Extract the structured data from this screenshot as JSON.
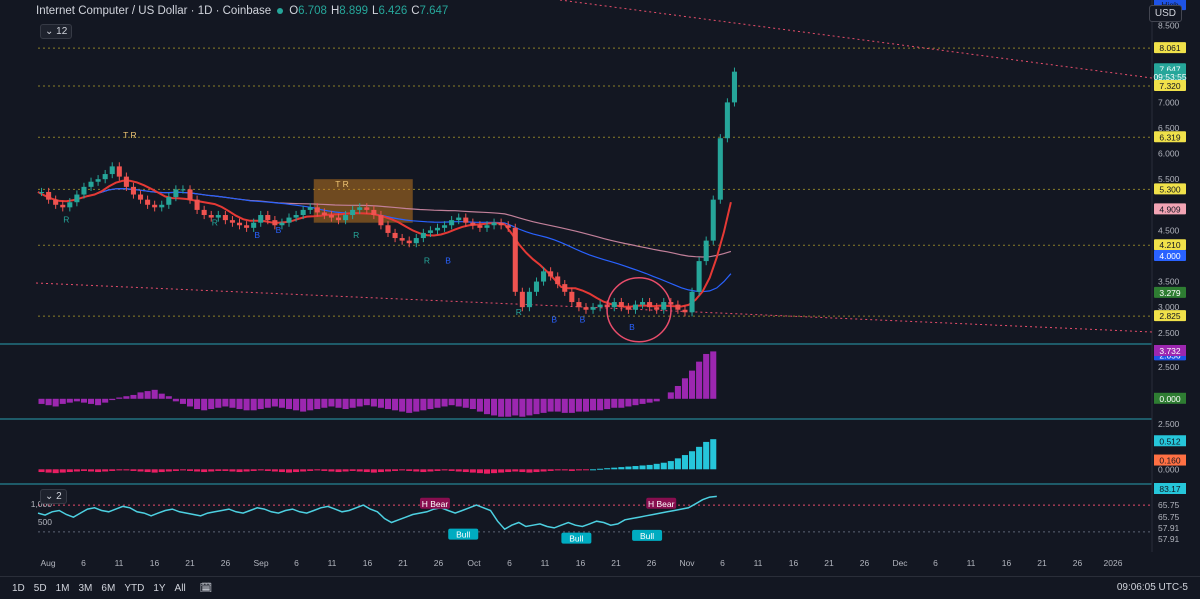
{
  "header": {
    "title": "Internet Computer / US Dollar · 1D · Coinbase",
    "ohlc": [
      {
        "k": "O",
        "v": "6.708"
      },
      {
        "k": "H",
        "v": "8.899"
      },
      {
        "k": "L",
        "v": "6.426"
      },
      {
        "k": "C",
        "v": "7.647"
      }
    ],
    "interval_chip": "12",
    "volume_chip": "2",
    "currency": "USD"
  },
  "footer": {
    "ranges": [
      "1D",
      "5D",
      "1M",
      "3M",
      "6M",
      "YTD",
      "1Y",
      "All"
    ],
    "clock": "09:06:05 UTC-5"
  },
  "colors": {
    "bg": "#131722",
    "up": "#26a69a",
    "down": "#ef5350",
    "accent_yellow": "#f0e14a",
    "ema_red": "#e53935",
    "ma_blue": "#2962ff",
    "ma_pink": "#c2809a"
  },
  "chart_data": [
    {
      "type": "line",
      "panel": "price",
      "y_ticks": [
        "2.500",
        "3.000",
        "3.500",
        "4.500",
        "5.500",
        "6.000",
        "6.500",
        "7.000",
        "8.500"
      ],
      "ylim": [
        2.3,
        9.0
      ],
      "x_ticks": [
        "Aug",
        "6",
        "11",
        "16",
        "21",
        "26",
        "Sep",
        "6",
        "11",
        "16",
        "21",
        "26",
        "Oct",
        "6",
        "11",
        "16",
        "21",
        "26",
        "Nov",
        "6",
        "11",
        "16",
        "21",
        "26",
        "Dec",
        "6",
        "11",
        "16",
        "21",
        "26",
        "2026"
      ],
      "price_labels": [
        {
          "text": "High",
          "color": "#131722",
          "bg": "#1e53e5",
          "value": 8.9
        },
        {
          "text": "8.061",
          "color": "#131722",
          "bg": "#f0e14a",
          "value": 8.061
        },
        {
          "text": "7.647",
          "color": "#ffffff",
          "bg": "#26a69a",
          "value": 7.647
        },
        {
          "text": "09:53:55",
          "color": "#ffffff",
          "bg": "#26a69a",
          "value": 7.5
        },
        {
          "text": "7.320",
          "color": "#131722",
          "bg": "#f0e14a",
          "value": 7.32
        },
        {
          "text": "6.319",
          "color": "#131722",
          "bg": "#f0e14a",
          "value": 6.319
        },
        {
          "text": "5.300",
          "color": "#131722",
          "bg": "#f0e14a",
          "value": 5.3
        },
        {
          "text": "4.909",
          "color": "#131722",
          "bg": "#f2a4b4",
          "value": 4.909
        },
        {
          "text": "4.210",
          "color": "#131722",
          "bg": "#f0e14a",
          "value": 4.21
        },
        {
          "text": "4.000",
          "color": "#ffffff",
          "bg": "#2962ff",
          "value": 4.0
        },
        {
          "text": "3.279",
          "color": "#ffffff",
          "bg": "#2e7d32",
          "value": 3.279
        },
        {
          "text": "2.825",
          "color": "#131722",
          "bg": "#f0e14a",
          "value": 2.825
        },
        {
          "text": "Low",
          "color": "#ffffff",
          "bg": "#1e53e5",
          "value": 2.06
        },
        {
          "text": "2.056",
          "color": "#ffffff",
          "bg": "#1e53e5",
          "value": 2.06
        }
      ],
      "closes": [
        5.25,
        5.1,
        5.0,
        4.95,
        5.05,
        5.2,
        5.35,
        5.45,
        5.5,
        5.6,
        5.75,
        5.55,
        5.35,
        5.2,
        5.1,
        5.0,
        4.95,
        5.0,
        5.15,
        5.3,
        5.3,
        5.1,
        4.9,
        4.8,
        4.75,
        4.8,
        4.7,
        4.65,
        4.6,
        4.55,
        4.65,
        4.8,
        4.7,
        4.6,
        4.65,
        4.75,
        4.8,
        4.9,
        4.95,
        4.85,
        4.8,
        4.75,
        4.7,
        4.8,
        4.9,
        4.95,
        4.9,
        4.8,
        4.6,
        4.45,
        4.35,
        4.3,
        4.25,
        4.35,
        4.45,
        4.5,
        4.55,
        4.6,
        4.7,
        4.75,
        4.65,
        4.6,
        4.55,
        4.6,
        4.65,
        4.6,
        4.55,
        3.3,
        3.0,
        3.3,
        3.5,
        3.7,
        3.6,
        3.45,
        3.3,
        3.1,
        3.0,
        2.95,
        3.0,
        3.05,
        3.0,
        3.1,
        3.0,
        2.95,
        3.05,
        3.1,
        3.0,
        2.95,
        3.1,
        3.05,
        2.95,
        2.9,
        3.3,
        3.9,
        4.3,
        5.1,
        6.3,
        7.0,
        7.6
      ],
      "annotations": [
        {
          "text": "T R",
          "day": 13,
          "value": 6.3,
          "color": "#f0c674"
        },
        {
          "text": "T R",
          "day": 43,
          "value": 5.35,
          "color": "#f0c674"
        },
        {
          "text": "R",
          "day": 4,
          "value": 4.65,
          "color": "#26a69a"
        },
        {
          "text": "R",
          "day": 25,
          "value": 4.6,
          "color": "#26a69a"
        },
        {
          "text": "B",
          "day": 31,
          "value": 4.35,
          "color": "#2962ff"
        },
        {
          "text": "B",
          "day": 34,
          "value": 4.45,
          "color": "#2962ff"
        },
        {
          "text": "R",
          "day": 45,
          "value": 4.35,
          "color": "#26a69a"
        },
        {
          "text": "R",
          "day": 55,
          "value": 3.85,
          "color": "#26a69a"
        },
        {
          "text": "B",
          "day": 58,
          "value": 3.85,
          "color": "#2962ff"
        },
        {
          "text": "R",
          "day": 68,
          "value": 2.85,
          "color": "#26a69a"
        },
        {
          "text": "B",
          "day": 73,
          "value": 2.7,
          "color": "#2962ff"
        },
        {
          "text": "B",
          "day": 77,
          "value": 2.7,
          "color": "#2962ff"
        },
        {
          "text": "B",
          "day": 84,
          "value": 2.55,
          "color": "#2962ff"
        }
      ]
    },
    {
      "type": "bar",
      "panel": "oscillator_1",
      "y_ticks": [
        "3.732",
        "2.500",
        "0.000"
      ],
      "ylim": [
        -1.5,
        4.2
      ],
      "values": [
        -0.4,
        -0.5,
        -0.6,
        -0.4,
        -0.3,
        -0.2,
        -0.3,
        -0.4,
        -0.5,
        -0.3,
        -0.1,
        0.1,
        0.2,
        0.3,
        0.5,
        0.6,
        0.7,
        0.4,
        0.2,
        -0.2,
        -0.4,
        -0.6,
        -0.8,
        -0.9,
        -0.8,
        -0.7,
        -0.6,
        -0.7,
        -0.8,
        -0.9,
        -0.9,
        -0.8,
        -0.7,
        -0.6,
        -0.7,
        -0.8,
        -0.9,
        -1.0,
        -0.9,
        -0.8,
        -0.7,
        -0.6,
        -0.7,
        -0.8,
        -0.7,
        -0.6,
        -0.5,
        -0.6,
        -0.7,
        -0.8,
        -0.9,
        -1.0,
        -1.1,
        -1.0,
        -0.9,
        -0.8,
        -0.7,
        -0.6,
        -0.5,
        -0.6,
        -0.7,
        -0.8,
        -1.0,
        -1.2,
        -1.3,
        -1.4,
        -1.4,
        -1.3,
        -1.4,
        -1.3,
        -1.2,
        -1.1,
        -1.0,
        -1.0,
        -1.1,
        -1.1,
        -1.0,
        -1.0,
        -0.9,
        -0.9,
        -0.8,
        -0.7,
        -0.7,
        -0.6,
        -0.5,
        -0.4,
        -0.3,
        -0.2,
        0.0,
        0.5,
        1.0,
        1.6,
        2.2,
        2.9,
        3.5,
        3.7
      ]
    },
    {
      "type": "bar",
      "panel": "oscillator_2",
      "y_ticks": [
        "2.500",
        "0.512",
        "0.160",
        "0.000"
      ],
      "ylim": [
        -0.25,
        0.9
      ],
      "values": [
        -0.05,
        -0.06,
        -0.07,
        -0.06,
        -0.05,
        -0.04,
        -0.03,
        -0.04,
        -0.05,
        -0.04,
        -0.03,
        -0.02,
        -0.02,
        -0.03,
        -0.04,
        -0.05,
        -0.06,
        -0.05,
        -0.04,
        -0.03,
        -0.02,
        -0.03,
        -0.04,
        -0.05,
        -0.04,
        -0.03,
        -0.03,
        -0.04,
        -0.05,
        -0.04,
        -0.03,
        -0.02,
        -0.03,
        -0.04,
        -0.05,
        -0.06,
        -0.05,
        -0.04,
        -0.03,
        -0.02,
        -0.03,
        -0.04,
        -0.05,
        -0.04,
        -0.03,
        -0.04,
        -0.05,
        -0.06,
        -0.05,
        -0.04,
        -0.03,
        -0.02,
        -0.03,
        -0.04,
        -0.05,
        -0.04,
        -0.03,
        -0.02,
        -0.03,
        -0.04,
        -0.05,
        -0.06,
        -0.07,
        -0.08,
        -0.07,
        -0.06,
        -0.05,
        -0.04,
        -0.05,
        -0.06,
        -0.05,
        -0.04,
        -0.03,
        -0.02,
        -0.02,
        -0.03,
        -0.02,
        -0.01,
        0.0,
        0.01,
        0.02,
        0.03,
        0.04,
        0.05,
        0.06,
        0.07,
        0.08,
        0.1,
        0.12,
        0.15,
        0.2,
        0.26,
        0.33,
        0.41,
        0.5,
        0.55
      ]
    },
    {
      "type": "line",
      "panel": "rsi_volume",
      "y_ticks": [
        "1,000",
        "500",
        "83.17",
        "65.75",
        "65.75",
        "57.91",
        "57.91"
      ],
      "ylim": [
        0,
        100
      ],
      "values": [
        58,
        55,
        60,
        62,
        56,
        52,
        58,
        64,
        66,
        62,
        60,
        64,
        68,
        66,
        60,
        58,
        54,
        58,
        62,
        64,
        60,
        58,
        56,
        54,
        58,
        60,
        62,
        64,
        60,
        58,
        62,
        66,
        64,
        60,
        58,
        62,
        64,
        60,
        58,
        62,
        66,
        68,
        64,
        60,
        62,
        66,
        70,
        64,
        60,
        50,
        44,
        48,
        52,
        56,
        58,
        60,
        64,
        66,
        62,
        58,
        62,
        66,
        70,
        66,
        62,
        46,
        34,
        40,
        44,
        38,
        40,
        42,
        38,
        36,
        40,
        44,
        40,
        38,
        42,
        46,
        44,
        40,
        42,
        48,
        50,
        52,
        54,
        56,
        58,
        60,
        62,
        64,
        66,
        72,
        78,
        82,
        83
      ],
      "badges": [
        {
          "text": "H Bear",
          "day": 56,
          "value": 72,
          "bg": "#880e4f"
        },
        {
          "text": "Bull",
          "day": 60,
          "value": 26,
          "bg": "#00acc1"
        },
        {
          "text": "Bull",
          "day": 86,
          "value": 24,
          "bg": "#00acc1"
        },
        {
          "text": "Bull",
          "day": 76,
          "value": 20,
          "bg": "#00acc1"
        },
        {
          "text": "H Bear",
          "day": 88,
          "value": 72,
          "bg": "#880e4f"
        }
      ]
    }
  ]
}
